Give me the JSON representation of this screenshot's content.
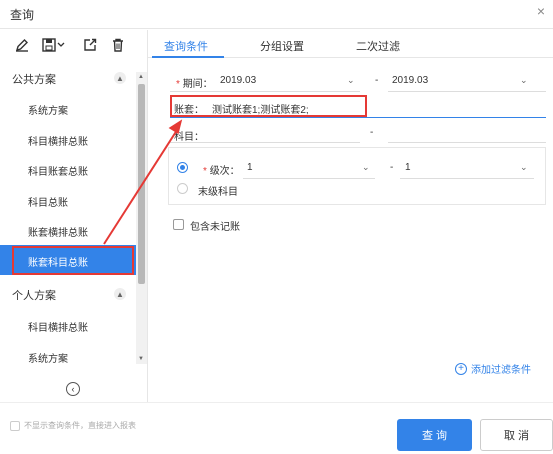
{
  "window": {
    "title": "查询",
    "close_glyph": "×"
  },
  "toolbar": {
    "icons": [
      "pencil-icon",
      "save-icon",
      "export-icon",
      "delete-icon"
    ]
  },
  "left": {
    "public_group": "公共方案",
    "public_items": [
      "系统方案",
      "科目横排总账",
      "科目账套总账",
      "科目总账",
      "账套横排总账",
      "账套科目总账"
    ],
    "active_index": 5,
    "personal_group": "个人方案",
    "personal_items": [
      "科目横排总账",
      "系统方案"
    ],
    "collapse_glyph": "‹"
  },
  "tabs": [
    "查询条件",
    "分组设置",
    "二次过滤"
  ],
  "active_tab": 0,
  "form": {
    "period_label": "期间：",
    "period_from": "2019.03",
    "period_sep": "-",
    "period_to": "2019.03",
    "account_label": "账套：",
    "account_value": "测试账套1;测试账套2;",
    "subject_label": "科目：",
    "subject_sep": "-",
    "level_label": "级次：",
    "level_from": "1",
    "level_sep": "-",
    "level_to": "1",
    "leaf_label": "末级科目",
    "include_unposted": "包含未记账",
    "add_filter": "添加过滤条件",
    "required_mark": "*"
  },
  "footer": {
    "skip_label": "不显示查询条件，直接进入报表",
    "query_button": "查 询",
    "cancel_button": "取 消"
  },
  "colors": {
    "accent": "#3383e8",
    "highlight": "#e53935"
  }
}
